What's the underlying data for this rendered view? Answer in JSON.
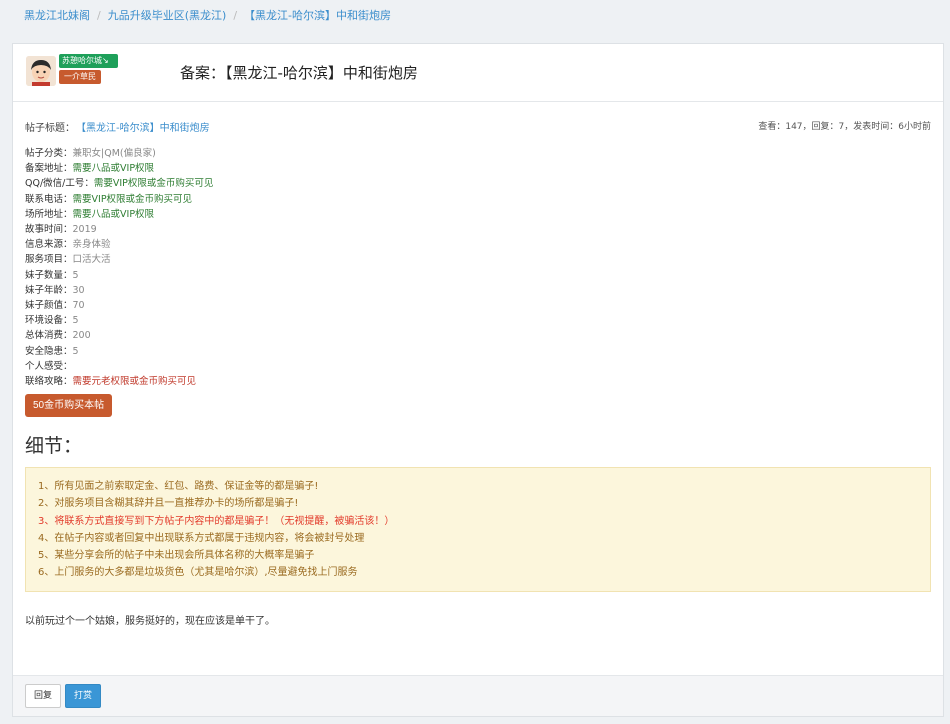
{
  "breadcrumb": [
    "黑龙江北妹阁",
    "九品升级毕业区(黑龙江)",
    "【黑龙江-哈尔滨】中和街炮房"
  ],
  "header": {
    "badge_top": "苏憩哈尔城↘",
    "badge_bottom": "一介草民",
    "title": "备案：【黑龙江-哈尔滨】中和街炮房"
  },
  "meta": {
    "title_label": "帖子标题：",
    "title_link": "【黑龙江-哈尔滨】中和街炮房",
    "stats": "查看：147，回复：7，发表时间：6小时前"
  },
  "fields": [
    {
      "label": "帖子分类：",
      "value": "兼职女|QM(偏良家)",
      "tone": "gray"
    },
    {
      "label": "备案地址：",
      "value": "需要八品或VIP权限",
      "tone": "green"
    },
    {
      "label": "QQ/微信/工号：",
      "value": "需要VIP权限或金币购买可见",
      "tone": "green"
    },
    {
      "label": "联系电话：",
      "value": "需要VIP权限或金币购买可见",
      "tone": "green"
    },
    {
      "label": "场所地址：",
      "value": "需要八品或VIP权限",
      "tone": "green"
    },
    {
      "label": "故事时间：",
      "value": "2019",
      "tone": "gray"
    },
    {
      "label": "信息来源：",
      "value": "亲身体验",
      "tone": "gray"
    },
    {
      "label": "服务项目：",
      "value": "口活大活",
      "tone": "gray"
    },
    {
      "label": "妹子数量：",
      "value": "5",
      "tone": "gray"
    },
    {
      "label": "妹子年龄：",
      "value": "30",
      "tone": "gray"
    },
    {
      "label": "妹子颜值：",
      "value": "70",
      "tone": "gray"
    },
    {
      "label": "环境设备：",
      "value": "5",
      "tone": "gray"
    },
    {
      "label": "总体消费：",
      "value": "200",
      "tone": "gray"
    },
    {
      "label": "安全隐患：",
      "value": "5",
      "tone": "gray"
    },
    {
      "label": "个人感受：",
      "value": "",
      "tone": "gray"
    },
    {
      "label": "联络攻略：",
      "value": "需要元老权限或金币购买可见",
      "tone": "red"
    }
  ],
  "buy_button": "50金币购买本帖",
  "detail_heading": "细节：",
  "warnings": [
    {
      "text": "1、所有见面之前索取定金、红包、路费、保证金等的都是骗子!",
      "tone": "normal"
    },
    {
      "text": "2、对服务项目含糊其辞并且一直推荐办卡的场所都是骗子!",
      "tone": "normal"
    },
    {
      "text": "3、将联系方式直接写到下方帖子内容中的都是骗子！（无视提醒，被骗活该！）",
      "tone": "red"
    },
    {
      "text": "4、在帖子内容或者回复中出现联系方式都属于违规内容，将会被封号处理",
      "tone": "normal"
    },
    {
      "text": "5、某些分享会所的帖子中未出现会所具体名称的大概率是骗子",
      "tone": "normal"
    },
    {
      "text": "6、上门服务的大多都是垃圾货色（尤其是哈尔滨）,尽量避免找上门服务",
      "tone": "normal"
    }
  ],
  "content": "以前玩过个一个姑娘，服务挺好的，现在应该是单干了。",
  "footer": {
    "reply_label": "回复",
    "tip_label": "打赏"
  }
}
